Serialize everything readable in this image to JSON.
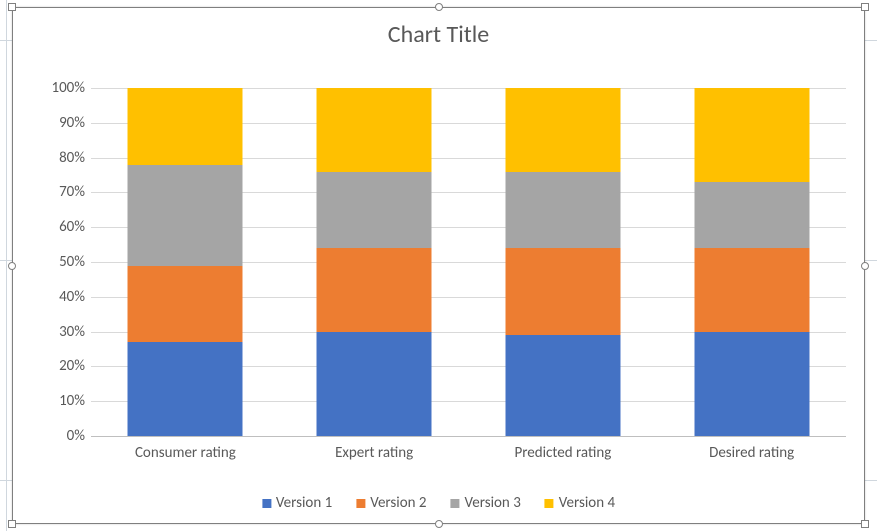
{
  "chart_data": {
    "type": "stacked-bar-100pct",
    "title": "Chart Title",
    "xlabel": "",
    "ylabel": "",
    "ylim": [
      0,
      100
    ],
    "yticks": [
      0,
      10,
      20,
      30,
      40,
      50,
      60,
      70,
      80,
      90,
      100
    ],
    "ytick_labels": [
      "0%",
      "10%",
      "20%",
      "30%",
      "40%",
      "50%",
      "60%",
      "70%",
      "80%",
      "90%",
      "100%"
    ],
    "categories": [
      "Consumer rating",
      "Expert rating",
      "Predicted rating",
      "Desired rating"
    ],
    "series": [
      {
        "name": "Version 1",
        "color": "#4472C4",
        "values_pct": [
          27,
          30,
          29,
          30
        ]
      },
      {
        "name": "Version 2",
        "color": "#ED7D31",
        "values_pct": [
          22,
          24,
          25,
          24
        ]
      },
      {
        "name": "Version 3",
        "color": "#A5A5A5",
        "values_pct": [
          29,
          22,
          22,
          19
        ]
      },
      {
        "name": "Version 4",
        "color": "#FFC000",
        "values_pct": [
          22,
          24,
          24,
          27
        ]
      }
    ],
    "legend_position": "bottom"
  }
}
